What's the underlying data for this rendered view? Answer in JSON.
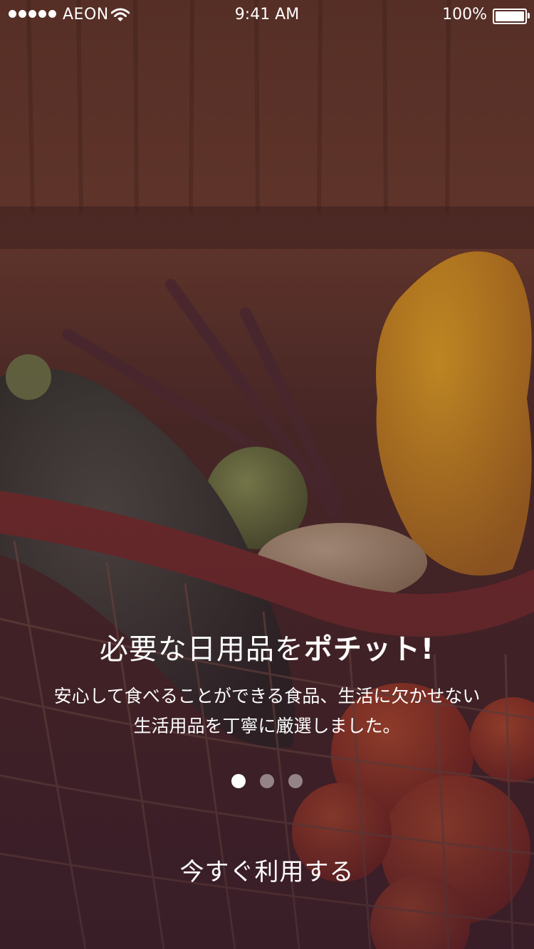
{
  "status_bar": {
    "carrier": "AEON",
    "time": "9:41 AM",
    "battery": "100%"
  },
  "onboarding": {
    "title_normal": "必要な日用品を",
    "title_bold": "ポチット!",
    "description_line1": "安心して食べることができる食品、生活に欠かせない",
    "description_line2": "生活用品を丁寧に厳選しました。",
    "page_count": 3,
    "active_page": 1,
    "cta_label": "今すぐ利用する"
  },
  "colors": {
    "overlay": "#3e1c28",
    "text": "#ffffff",
    "dot_inactive": "rgba(255,255,255,0.45)"
  }
}
